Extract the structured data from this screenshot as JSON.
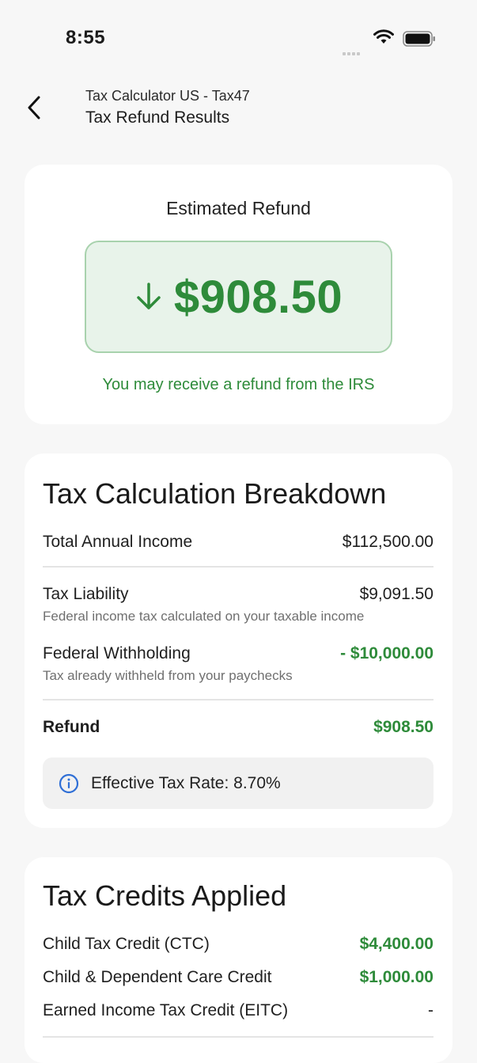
{
  "status_bar": {
    "time": "8:55"
  },
  "nav": {
    "subtitle": "Tax Calculator US - Tax47",
    "title": "Tax Refund Results"
  },
  "refund_card": {
    "label": "Estimated Refund",
    "amount": "$908.50",
    "note": "You may receive a refund from the IRS"
  },
  "breakdown": {
    "title": "Tax Calculation Breakdown",
    "rows": [
      {
        "label": "Total Annual Income",
        "value": "$112,500.00"
      },
      {
        "label": "Tax Liability",
        "value": "$9,091.50",
        "description": "Federal income tax calculated on your taxable income"
      },
      {
        "label": "Federal Withholding",
        "value": "- $10,000.00",
        "description": "Tax already withheld from your paychecks"
      },
      {
        "label": "Refund",
        "value": "$908.50"
      }
    ],
    "effective_rate": "Effective Tax Rate: 8.70%"
  },
  "credits": {
    "title": "Tax Credits Applied",
    "rows": [
      {
        "label": "Child Tax Credit (CTC)",
        "value": "$4,400.00"
      },
      {
        "label": "Child & Dependent Care Credit",
        "value": "$1,000.00"
      },
      {
        "label": "Earned Income Tax Credit (EITC)",
        "value": "-"
      }
    ]
  },
  "colors": {
    "accent_green": "#2e8b3a",
    "refund_box_bg": "#e8f3ea",
    "info_blue": "#2f6fd6"
  },
  "icons": {
    "back": "chevron-left-icon",
    "refund_direction": "arrow-down-icon",
    "info": "info-icon",
    "wifi": "wifi-icon",
    "battery": "battery-icon",
    "signal": "signal-icon"
  }
}
